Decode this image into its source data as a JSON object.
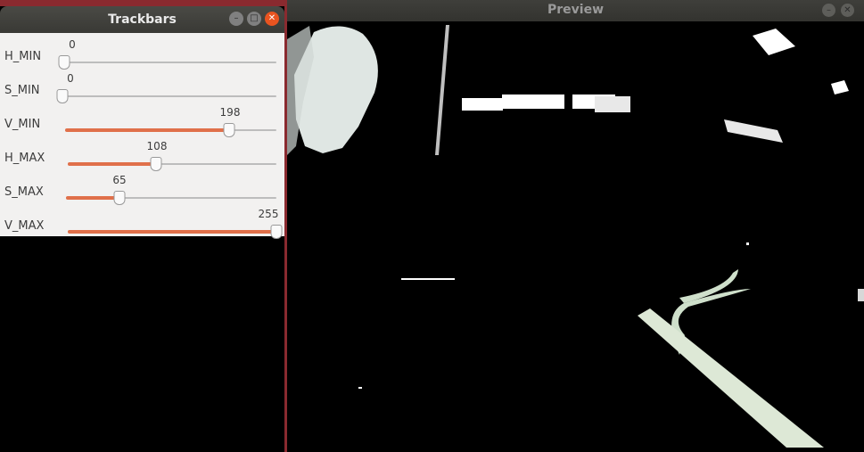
{
  "trackbars_window": {
    "title": "Trackbars",
    "controls": [
      {
        "label": "H_MIN",
        "value": "0",
        "fraction": 0.0
      },
      {
        "label": "S_MIN",
        "value": "0",
        "fraction": 0.0
      },
      {
        "label": "V_MIN",
        "value": "198",
        "fraction": 0.776
      },
      {
        "label": "H_MAX",
        "value": "108",
        "fraction": 0.424
      },
      {
        "label": "S_MAX",
        "value": "65",
        "fraction": 0.255
      },
      {
        "label": "V_MAX",
        "value": "255",
        "fraction": 1.0
      }
    ],
    "buttons": {
      "minimize_icon": "minimize-icon",
      "maximize_icon": "maximize-icon",
      "close_icon": "close-icon"
    },
    "accent_color": "#e0704a"
  },
  "preview_window": {
    "title": "Preview",
    "buttons": {
      "minimize_icon": "minimize-icon",
      "close_icon": "close-icon"
    }
  }
}
